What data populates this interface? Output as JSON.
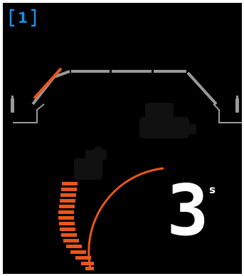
{
  "camera": {
    "number": "1",
    "icon": "camera-view-bracket-icon"
  },
  "car": {
    "icon": "car-silhouette-icon"
  },
  "timer": {
    "value": "3",
    "unit": "s"
  },
  "gauge": {
    "level": 0.5
  },
  "colors": {
    "accent_orange": "#e8561f",
    "camera_blue": "#1a8fe8",
    "line_gray": "#9a9a9a",
    "background": "#000000",
    "text": "#ffffff"
  }
}
